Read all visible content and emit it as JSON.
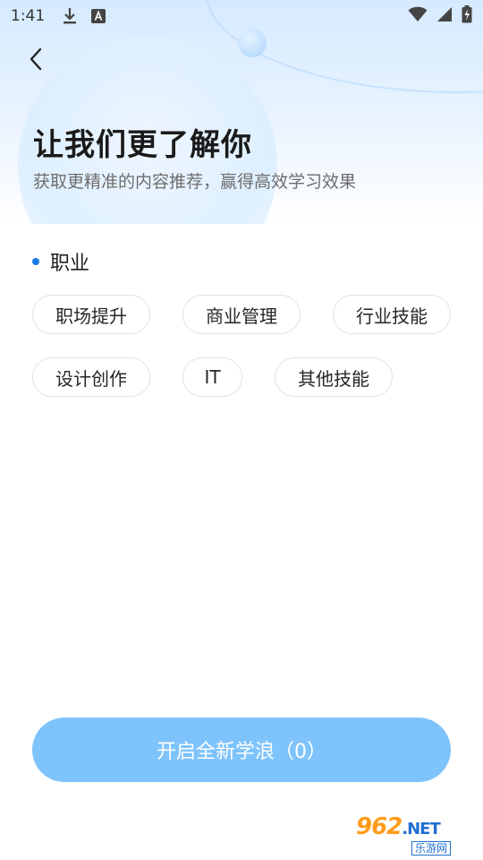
{
  "status_bar": {
    "time": "1:41",
    "left_icons": [
      "download-icon",
      "keyboard-a-icon"
    ],
    "right_icons": [
      "wifi-icon",
      "signal-icon",
      "battery-charging-icon"
    ]
  },
  "header": {
    "back_icon": "back-arrow-icon",
    "title": "让我们更了解你",
    "subtitle": "获取更精准的内容推荐，赢得高效学习效果"
  },
  "section": {
    "label": "职业",
    "tags": [
      "职场提升",
      "商业管理",
      "行业技能",
      "设计创作",
      "IT",
      "其他技能"
    ]
  },
  "action": {
    "label": "开启全新学浪（0）"
  },
  "watermark": {
    "logo": "962",
    "logo_suffix": ".NET",
    "sub": "乐游网"
  },
  "colors": {
    "accent": "#1b78e8",
    "button": "#7ec3fb",
    "tag_border": "#e2e2e2"
  }
}
